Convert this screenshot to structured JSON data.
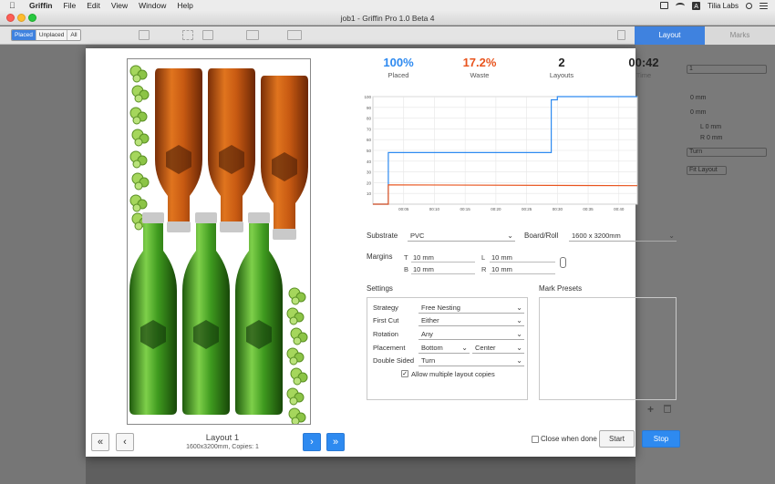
{
  "menubar": {
    "items": [
      "Griffin",
      "File",
      "Edit",
      "View",
      "Window",
      "Help"
    ],
    "account": "Tilia Labs"
  },
  "window": {
    "title": "job1 - Griffin Pro 1.0 Beta 4"
  },
  "toolbar": {
    "filter": [
      "Placed",
      "Unplaced",
      "All"
    ],
    "tabs": [
      "Layout",
      "Marks"
    ]
  },
  "background_panel": {
    "value1": "1",
    "margin_l": "L 0 mm",
    "margin_r": "R 0 mm",
    "turn": "Turn",
    "fit": "Fit Layout",
    "mm1": "0 mm",
    "mm2": "0 mm"
  },
  "stats": [
    {
      "value": "100%",
      "label": "Placed",
      "color": "#2e8af0"
    },
    {
      "value": "17.2%",
      "label": "Waste",
      "color": "#e8541e"
    },
    {
      "value": "2",
      "label": "Layouts",
      "color": "#111111"
    },
    {
      "value": "00:42",
      "label": "Time",
      "color": "#111111"
    }
  ],
  "chart_data": {
    "type": "line",
    "x_ticks": [
      "00:05",
      "00:10",
      "00:15",
      "00:20",
      "00:25",
      "00:30",
      "00:35",
      "00:40"
    ],
    "y_ticks": [
      10,
      20,
      30,
      40,
      50,
      60,
      70,
      80,
      90,
      100
    ],
    "ylim": [
      0,
      100
    ],
    "xlim": [
      0,
      43
    ],
    "grid": true,
    "series": [
      {
        "color": "#2e8af0",
        "points": [
          [
            0,
            0
          ],
          [
            2.5,
            0
          ],
          [
            2.5,
            48
          ],
          [
            29,
            48
          ],
          [
            29,
            97
          ],
          [
            30,
            97
          ],
          [
            30,
            100
          ],
          [
            43,
            100
          ]
        ]
      },
      {
        "color": "#e8541e",
        "points": [
          [
            0,
            0
          ],
          [
            2.5,
            0
          ],
          [
            2.5,
            18
          ],
          [
            43,
            17.2
          ]
        ]
      }
    ]
  },
  "substrate": {
    "label": "Substrate",
    "value": "PVC"
  },
  "board": {
    "label": "Board/Roll",
    "value": "1600 x 3200mm"
  },
  "margins": {
    "label": "Margins",
    "t_label": "T",
    "t": "10 mm",
    "b_label": "B",
    "b": "10 mm",
    "l_label": "L",
    "l": "10 mm",
    "r_label": "R",
    "r": "10 mm"
  },
  "settings": {
    "title": "Settings",
    "strategy_label": "Strategy",
    "strategy": "Free Nesting",
    "firstcut_label": "First Cut",
    "firstcut": "Either",
    "rotation_label": "Rotation",
    "rotation": "Any",
    "placement_label": "Placement",
    "placement_v": "Bottom",
    "placement_h": "Center",
    "doublesided_label": "Double Sided",
    "doublesided": "Turn",
    "multi_label": "Allow multiple layout copies"
  },
  "marks": {
    "title": "Mark Presets"
  },
  "layout": {
    "title": "Layout 1",
    "subtitle": "1600x3200mm, Copies: 1"
  },
  "footer": {
    "close_label": "Close when done",
    "start": "Start",
    "stop": "Stop"
  }
}
